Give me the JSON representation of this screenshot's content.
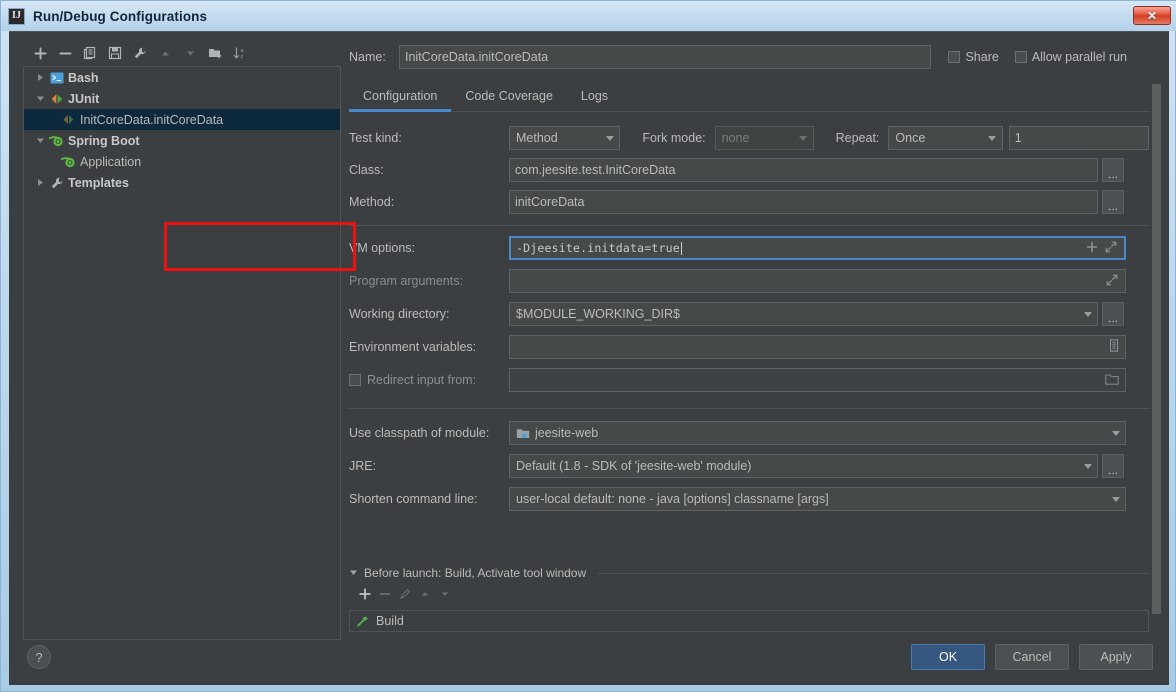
{
  "window": {
    "title": "Run/Debug Configurations",
    "app_icon": "IJ",
    "close_label": "✕"
  },
  "sidebar": {
    "toolbar": [
      {
        "name": "add-configuration-button",
        "icon": "plus-icon"
      },
      {
        "name": "remove-configuration-button",
        "icon": "minus-icon"
      },
      {
        "name": "copy-configuration-button",
        "icon": "copy-icon"
      },
      {
        "name": "save-configuration-button",
        "icon": "save-icon"
      },
      {
        "name": "edit-templates-button",
        "icon": "wrench-icon"
      },
      {
        "name": "move-up-button",
        "icon": "arrow-up-icon"
      },
      {
        "name": "move-down-button",
        "icon": "arrow-down-icon"
      },
      {
        "name": "create-folder-button",
        "icon": "folder-add-icon"
      },
      {
        "name": "sort-configurations-button",
        "icon": "sort-az-icon"
      }
    ],
    "tree": [
      {
        "label": "Bash",
        "level": 0,
        "twisty": "collapsed",
        "icon": "bash-icon",
        "selected": false,
        "leaf": false
      },
      {
        "label": "JUnit",
        "level": 0,
        "twisty": "expanded",
        "icon": "junit-icon",
        "selected": false,
        "leaf": false
      },
      {
        "label": "InitCoreData.initCoreData",
        "level": 1,
        "twisty": "none",
        "icon": "junit-icon",
        "selected": true,
        "leaf": true
      },
      {
        "label": "Spring Boot",
        "level": 0,
        "twisty": "expanded",
        "icon": "spring-icon",
        "selected": false,
        "leaf": false
      },
      {
        "label": "Application",
        "level": 1,
        "twisty": "none",
        "icon": "spring-icon",
        "selected": false,
        "leaf": true
      },
      {
        "label": "Templates",
        "level": 0,
        "twisty": "collapsed",
        "icon": "wrench-icon",
        "selected": false,
        "leaf": false
      }
    ]
  },
  "header": {
    "name_label": "Name:",
    "name_value": "InitCoreData.initCoreData",
    "share_label": "Share",
    "share_checked": false,
    "allow_parallel_label": "Allow parallel run",
    "allow_parallel_checked": false
  },
  "tabs": [
    {
      "label": "Configuration",
      "active": true
    },
    {
      "label": "Code Coverage",
      "active": false
    },
    {
      "label": "Logs",
      "active": false
    }
  ],
  "form": {
    "test_kind_label": "Test kind:",
    "test_kind_value": "Method",
    "fork_mode_label": "Fork mode:",
    "fork_mode_value": "none",
    "repeat_label": "Repeat:",
    "repeat_value": "Once",
    "repeat_count_value": "1",
    "class_label": "Class:",
    "class_value": "com.jeesite.test.InitCoreData",
    "method_label": "Method:",
    "method_value": "initCoreData",
    "vm_options_label": "VM options:",
    "vm_options_value": "-Djeesite.initdata=true",
    "program_arguments_label": "Program arguments:",
    "program_arguments_value": "",
    "working_directory_label": "Working directory:",
    "working_directory_value": "$MODULE_WORKING_DIR$",
    "environment_variables_label": "Environment variables:",
    "environment_variables_value": "",
    "redirect_input_label": "Redirect input from:",
    "redirect_input_checked": false,
    "redirect_input_value": "",
    "use_classpath_label": "Use classpath of module:",
    "use_classpath_value": "jeesite-web",
    "jre_label": "JRE:",
    "jre_value": "Default (1.8 - SDK of 'jeesite-web' module)",
    "shorten_command_line_label": "Shorten command line:",
    "shorten_command_line_value": "user-local default: none - java [options] classname [args]",
    "ellipsis_label": "..."
  },
  "before_launch": {
    "header": "Before launch: Build, Activate tool window",
    "toolbar": [
      {
        "name": "add-task-button",
        "icon": "plus-icon",
        "enabled": true
      },
      {
        "name": "remove-task-button",
        "icon": "minus-icon",
        "enabled": false
      },
      {
        "name": "edit-task-button",
        "icon": "pencil-icon",
        "enabled": false
      },
      {
        "name": "move-task-up-button",
        "icon": "arrow-up-icon",
        "enabled": false
      },
      {
        "name": "move-task-down-button",
        "icon": "arrow-down-icon",
        "enabled": false
      }
    ],
    "tasks": [
      {
        "label": "Build",
        "icon": "build-hammer-icon"
      }
    ]
  },
  "footer": {
    "help_label": "?",
    "ok_label": "OK",
    "cancel_label": "Cancel",
    "apply_label": "Apply"
  },
  "colors": {
    "accent_blue": "#4a88c7",
    "default_button": "#365880",
    "panel_bg": "#3c3f41",
    "field_bg": "#45494a",
    "selection_bg": "#0d293e",
    "annotation_red": "#ee1111"
  }
}
